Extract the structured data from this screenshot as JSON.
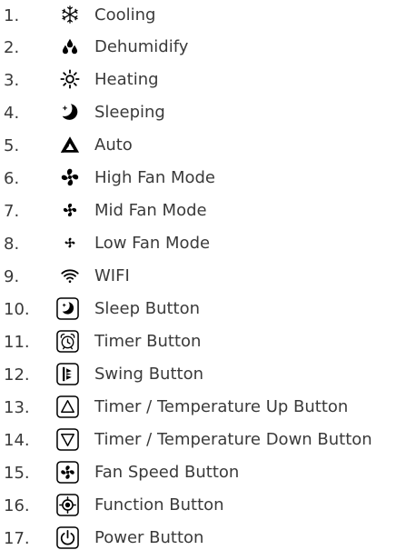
{
  "legend": {
    "items": [
      {
        "number": "1.",
        "label": "Cooling",
        "icon": "snowflake-icon"
      },
      {
        "number": "2.",
        "label": "Dehumidify",
        "icon": "water-drops-icon"
      },
      {
        "number": "3.",
        "label": "Heating",
        "icon": "sun-icon"
      },
      {
        "number": "4.",
        "label": "Sleeping",
        "icon": "moon-icon"
      },
      {
        "number": "5.",
        "label": "Auto",
        "icon": "auto-triangle-icon"
      },
      {
        "number": "6.",
        "label": "High Fan Mode",
        "icon": "fan-high-icon"
      },
      {
        "number": "7.",
        "label": "Mid Fan Mode",
        "icon": "fan-mid-icon"
      },
      {
        "number": "8.",
        "label": "Low Fan Mode",
        "icon": "fan-low-icon"
      },
      {
        "number": "9.",
        "label": "WIFI",
        "icon": "wifi-icon"
      },
      {
        "number": "10.",
        "label": "Sleep Button",
        "icon": "sleep-button-icon"
      },
      {
        "number": "11.",
        "label": "Timer Button",
        "icon": "timer-button-icon"
      },
      {
        "number": "12.",
        "label": "Swing Button",
        "icon": "swing-button-icon"
      },
      {
        "number": "13.",
        "label": "Timer / Temperature Up Button",
        "icon": "up-button-icon"
      },
      {
        "number": "14.",
        "label": "Timer / Temperature Down Button",
        "icon": "down-button-icon"
      },
      {
        "number": "15.",
        "label": "Fan Speed Button",
        "icon": "fan-speed-button-icon"
      },
      {
        "number": "16.",
        "label": "Function Button",
        "icon": "function-button-icon"
      },
      {
        "number": "17.",
        "label": "Power Button",
        "icon": "power-button-icon"
      }
    ]
  },
  "colors": {
    "text": "#3a3a3a",
    "icon": "#000000"
  }
}
